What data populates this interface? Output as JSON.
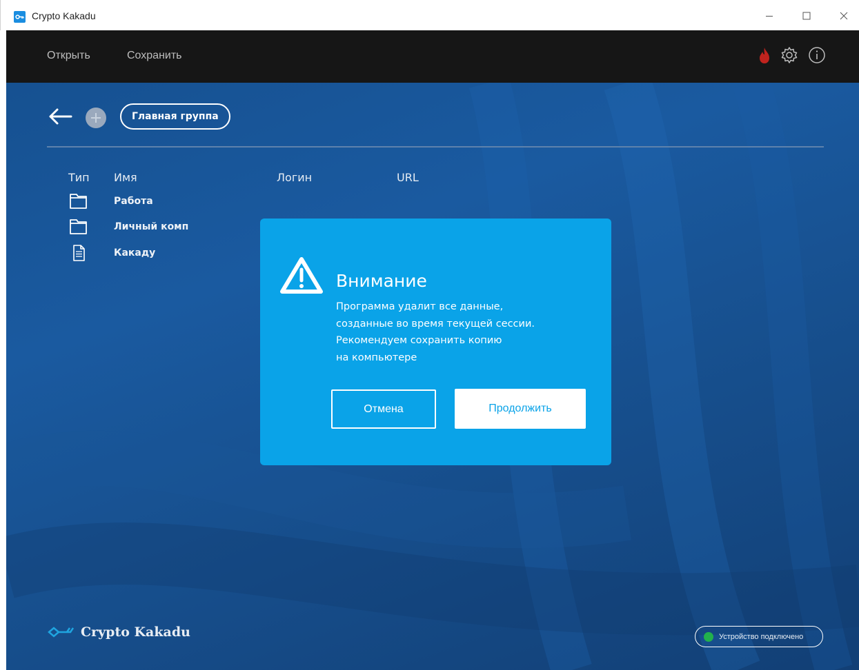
{
  "window": {
    "title": "Crypto Kakadu"
  },
  "toolbar": {
    "open_label": "Открыть",
    "save_label": "Сохранить",
    "icons": [
      "fire-icon",
      "gear-icon",
      "info-icon"
    ]
  },
  "nav": {
    "breadcrumb": "Главная группа"
  },
  "table": {
    "headers": {
      "type": "Тип",
      "name": "Имя",
      "login": "Логин",
      "url": "URL"
    },
    "rows": [
      {
        "type": "folder",
        "name": "Работа"
      },
      {
        "type": "folder",
        "name": "Личный комп"
      },
      {
        "type": "document",
        "name": "Какаду"
      }
    ]
  },
  "footer": {
    "brand": "Crypto Kakadu",
    "status": "Устройство подключено",
    "status_color": "#22b14c"
  },
  "dialog": {
    "title": "Внимание",
    "lines": [
      "Программа удалит все данные,",
      "созданные во время текущей сессии.",
      "Рекомендуем сохранить копию",
      "на компьютере"
    ],
    "cancel_label": "Отмена",
    "continue_label": "Продолжить",
    "accent_color": "#0aa3e8"
  }
}
